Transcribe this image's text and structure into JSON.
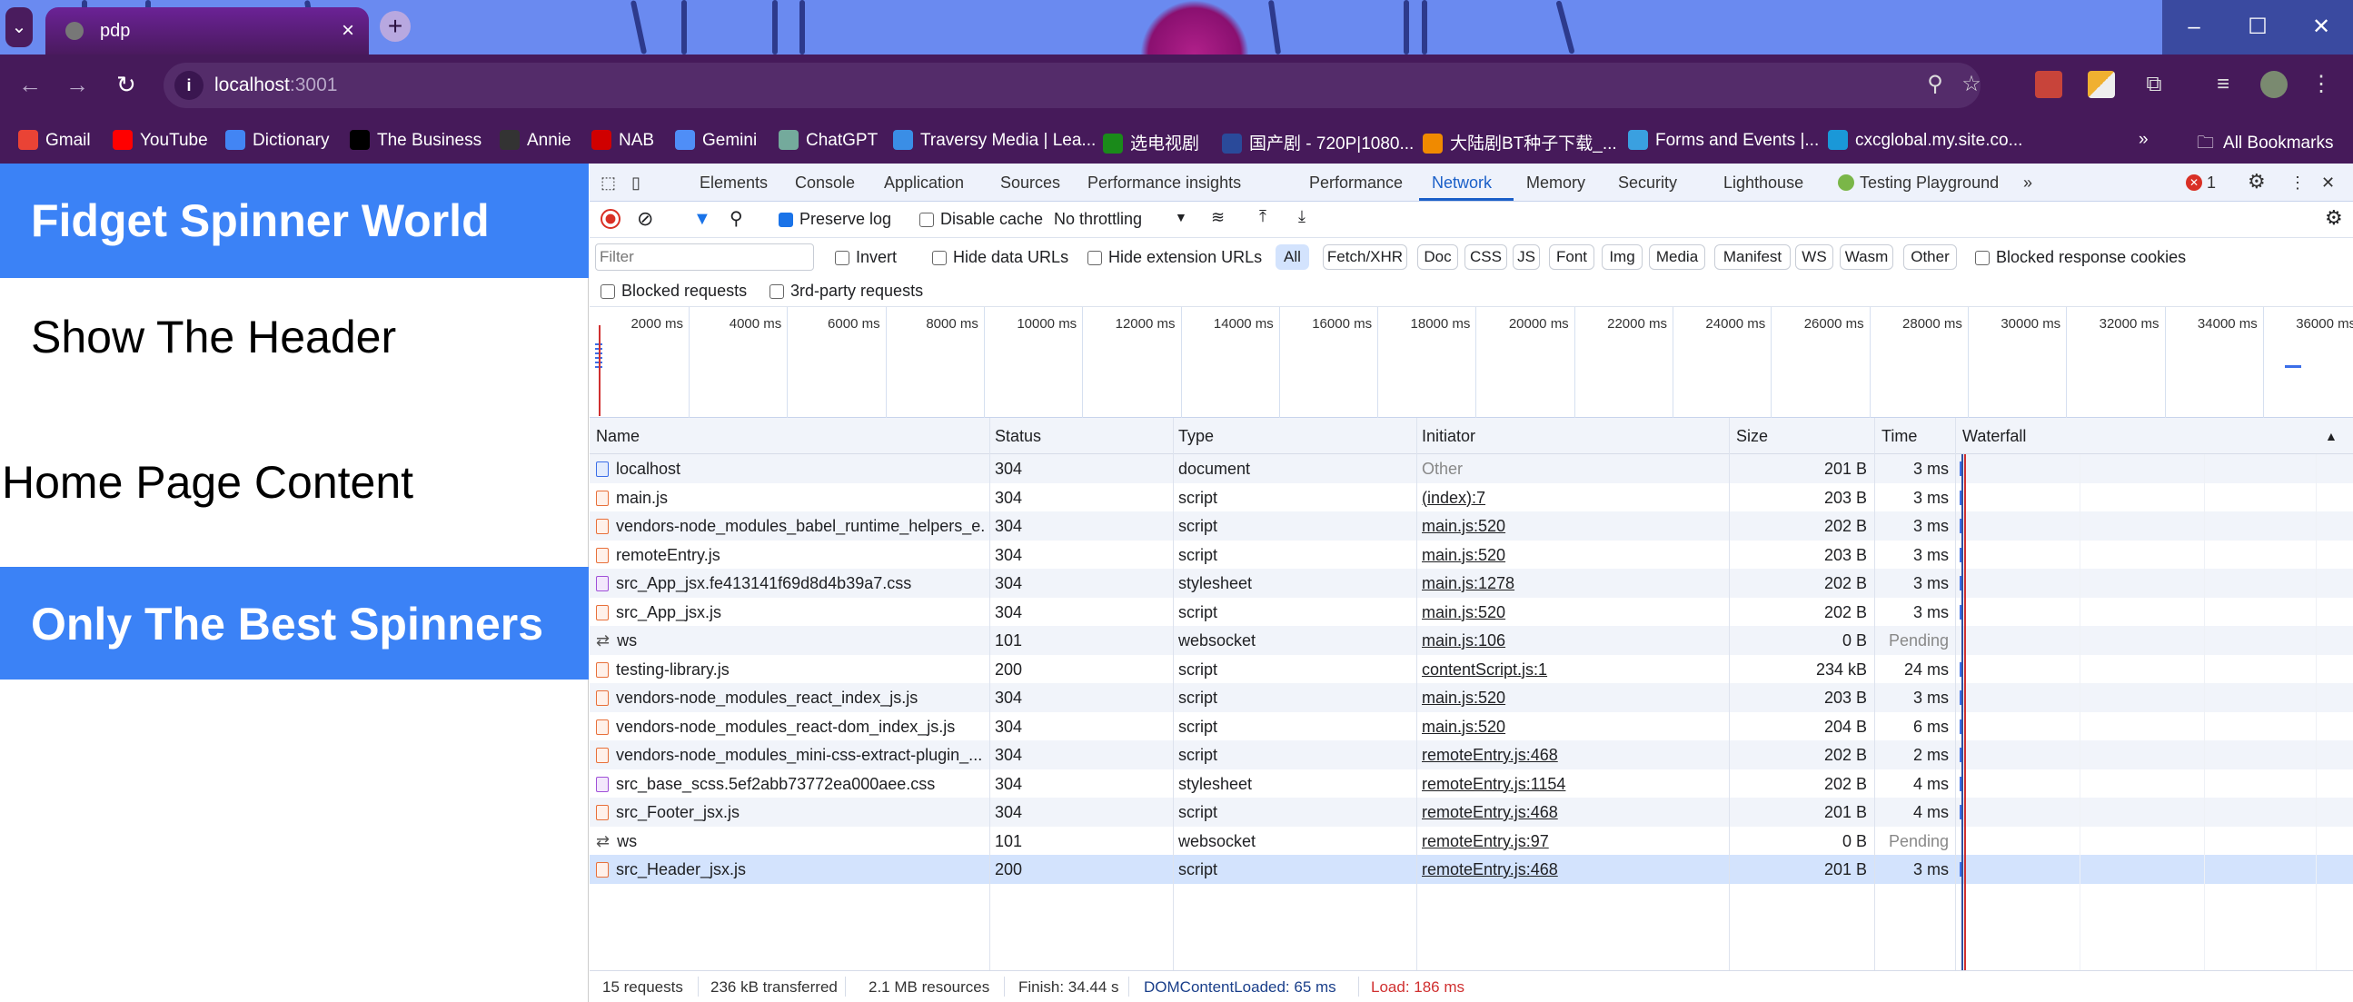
{
  "browser": {
    "tab_title": "pdp",
    "url_host": "localhost",
    "url_port": ":3001",
    "bookmarks": [
      {
        "label": "Gmail",
        "color": "#ea4335"
      },
      {
        "label": "YouTube",
        "color": "#ff0000"
      },
      {
        "label": "Dictionary",
        "color": "#4285f4"
      },
      {
        "label": "The Business",
        "color": "#000000"
      },
      {
        "label": "Annie",
        "color": "#333333"
      },
      {
        "label": "NAB",
        "color": "#d00000"
      },
      {
        "label": "Gemini",
        "color": "#4f8ef7"
      },
      {
        "label": "ChatGPT",
        "color": "#74aa9c"
      },
      {
        "label": "Traversy Media | Lea...",
        "color": "#3a8ee6"
      },
      {
        "label": "选电视剧",
        "color": "#1a8a1a"
      },
      {
        "label": "国产剧 - 720P|1080...",
        "color": "#2a4a9a"
      },
      {
        "label": "大陆剧BT种子下载_...",
        "color": "#f08a00"
      },
      {
        "label": "Forms and Events |...",
        "color": "#3aa0e0"
      },
      {
        "label": "cxcglobal.my.site.co...",
        "color": "#1a98d8"
      }
    ],
    "all_bookmarks": "All Bookmarks"
  },
  "page": {
    "header": "Fidget Spinner World",
    "show_header": "Show The Header",
    "home_content": "Home Page Content",
    "footer": "Only The Best Spinners"
  },
  "devtools": {
    "tabs": [
      "Elements",
      "Console",
      "Application",
      "Sources",
      "Performance insights",
      "Performance",
      "Network",
      "Memory",
      "Security",
      "Lighthouse",
      "Testing Playground"
    ],
    "active_tab": "Network",
    "error_count": "1",
    "toolbar": {
      "preserve_log": "Preserve log",
      "disable_cache": "Disable cache",
      "throttling": "No throttling"
    },
    "filter": {
      "placeholder": "Filter",
      "invert": "Invert",
      "hide_data_urls": "Hide data URLs",
      "hide_ext_urls": "Hide extension URLs",
      "types": [
        "All",
        "Fetch/XHR",
        "Doc",
        "CSS",
        "JS",
        "Font",
        "Img",
        "Media",
        "Manifest",
        "WS",
        "Wasm",
        "Other"
      ],
      "blocked_cookies": "Blocked response cookies",
      "blocked_requests": "Blocked requests",
      "third_party": "3rd-party requests"
    },
    "timeline_ticks": [
      "2000 ms",
      "4000 ms",
      "6000 ms",
      "8000 ms",
      "10000 ms",
      "12000 ms",
      "14000 ms",
      "16000 ms",
      "18000 ms",
      "20000 ms",
      "22000 ms",
      "24000 ms",
      "26000 ms",
      "28000 ms",
      "30000 ms",
      "32000 ms",
      "34000 ms",
      "36000 ms"
    ],
    "columns": [
      "Name",
      "Status",
      "Type",
      "Initiator",
      "Size",
      "Time",
      "Waterfall"
    ],
    "requests": [
      {
        "name": "localhost",
        "status": "304",
        "type": "document",
        "initiator": "Other",
        "size": "201 B",
        "time": "3 ms",
        "icon": "document-icon"
      },
      {
        "name": "main.js",
        "status": "304",
        "type": "script",
        "initiator": "(index):7",
        "size": "203 B",
        "time": "3 ms",
        "icon": "script-icon"
      },
      {
        "name": "vendors-node_modules_babel_runtime_helpers_e...",
        "status": "304",
        "type": "script",
        "initiator": "main.js:520",
        "size": "202 B",
        "time": "3 ms",
        "icon": "script-icon"
      },
      {
        "name": "remoteEntry.js",
        "status": "304",
        "type": "script",
        "initiator": "main.js:520",
        "size": "203 B",
        "time": "3 ms",
        "icon": "script-icon"
      },
      {
        "name": "src_App_jsx.fe413141f69d8d4b39a7.css",
        "status": "304",
        "type": "stylesheet",
        "initiator": "main.js:1278",
        "size": "202 B",
        "time": "3 ms",
        "icon": "stylesheet-icon"
      },
      {
        "name": "src_App_jsx.js",
        "status": "304",
        "type": "script",
        "initiator": "main.js:520",
        "size": "202 B",
        "time": "3 ms",
        "icon": "script-icon"
      },
      {
        "name": "ws",
        "status": "101",
        "type": "websocket",
        "initiator": "main.js:106",
        "size": "0 B",
        "time": "Pending",
        "icon": "websocket-icon"
      },
      {
        "name": "testing-library.js",
        "status": "200",
        "type": "script",
        "initiator": "contentScript.js:1",
        "size": "234 kB",
        "time": "24 ms",
        "icon": "script-icon"
      },
      {
        "name": "vendors-node_modules_react_index_js.js",
        "status": "304",
        "type": "script",
        "initiator": "main.js:520",
        "size": "203 B",
        "time": "3 ms",
        "icon": "script-icon"
      },
      {
        "name": "vendors-node_modules_react-dom_index_js.js",
        "status": "304",
        "type": "script",
        "initiator": "main.js:520",
        "size": "204 B",
        "time": "6 ms",
        "icon": "script-icon"
      },
      {
        "name": "vendors-node_modules_mini-css-extract-plugin_...",
        "status": "304",
        "type": "script",
        "initiator": "remoteEntry.js:468",
        "size": "202 B",
        "time": "2 ms",
        "icon": "script-icon"
      },
      {
        "name": "src_base_scss.5ef2abb73772ea000aee.css",
        "status": "304",
        "type": "stylesheet",
        "initiator": "remoteEntry.js:1154",
        "size": "202 B",
        "time": "4 ms",
        "icon": "stylesheet-icon"
      },
      {
        "name": "src_Footer_jsx.js",
        "status": "304",
        "type": "script",
        "initiator": "remoteEntry.js:468",
        "size": "201 B",
        "time": "4 ms",
        "icon": "script-icon"
      },
      {
        "name": "ws",
        "status": "101",
        "type": "websocket",
        "initiator": "remoteEntry.js:97",
        "size": "0 B",
        "time": "Pending",
        "icon": "websocket-icon"
      },
      {
        "name": "src_Header_jsx.js",
        "status": "200",
        "type": "script",
        "initiator": "remoteEntry.js:468",
        "size": "201 B",
        "time": "3 ms",
        "icon": "script-icon",
        "selected": true
      }
    ],
    "status_bar": {
      "requests": "15 requests",
      "transferred": "236 kB transferred",
      "resources": "2.1 MB resources",
      "finish": "Finish: 34.44 s",
      "dcl": "DOMContentLoaded: 65 ms",
      "load": "Load: 186 ms"
    },
    "colors": {
      "accent": "#1a5fc8",
      "dcl": "#1a3f8a",
      "load": "#d03030",
      "selected_row": "#d3e3fd"
    }
  }
}
